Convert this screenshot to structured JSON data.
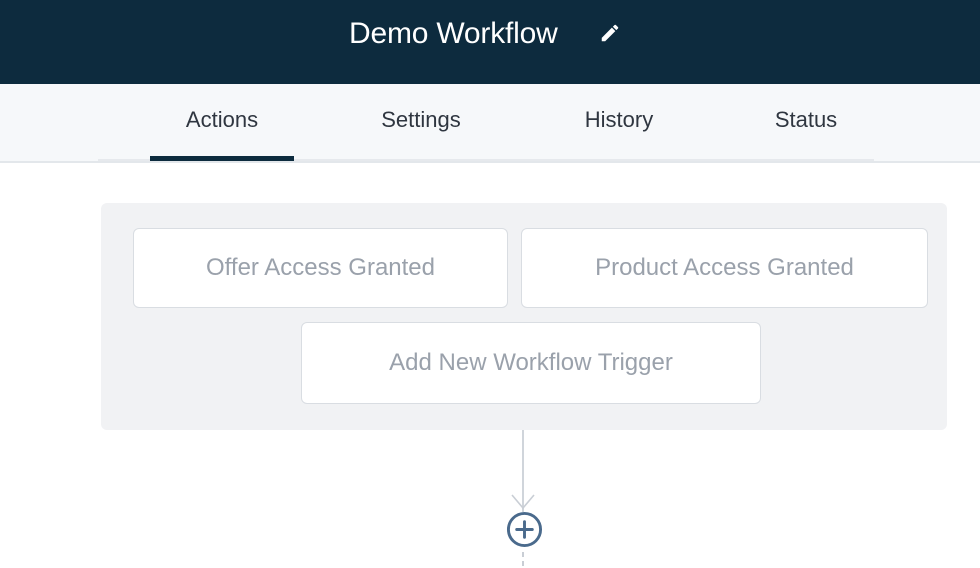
{
  "header": {
    "title": "Demo Workflow",
    "edit_icon": "pencil-icon",
    "background": "#0d2b3e"
  },
  "tabs": [
    {
      "label": "Actions",
      "active": true
    },
    {
      "label": "Settings",
      "active": false
    },
    {
      "label": "History",
      "active": false
    },
    {
      "label": "Status",
      "active": false
    }
  ],
  "triggers": {
    "items": [
      {
        "label": "Offer Access Granted"
      },
      {
        "label": "Product Access Granted"
      }
    ],
    "add_label": "Add New Workflow Trigger"
  },
  "flow": {
    "add_step_icon": "plus-circle-icon",
    "accent": "#4a6a8c"
  }
}
